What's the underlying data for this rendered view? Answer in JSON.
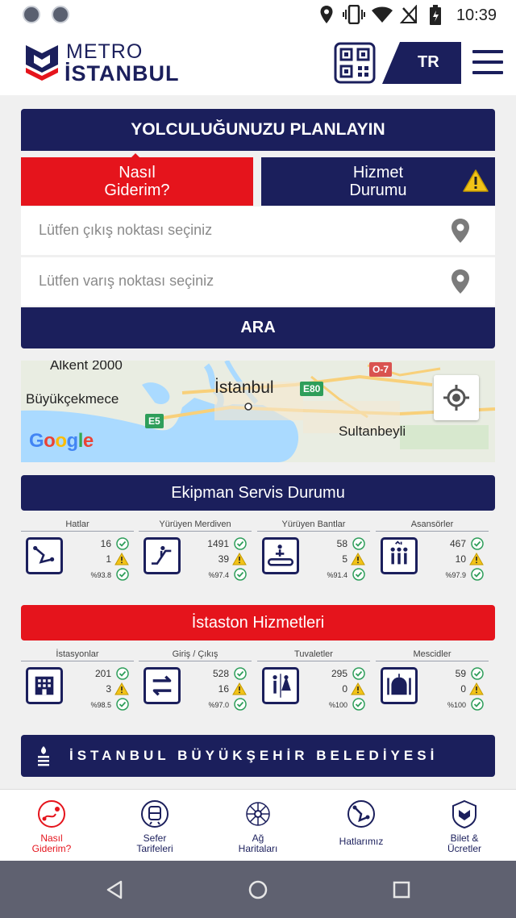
{
  "status_bar": {
    "time": "10:39"
  },
  "header": {
    "logo_line1": "METRO",
    "logo_line2": "İSTANBUL",
    "lang": "TR"
  },
  "planner": {
    "title": "YOLCULUĞUNUZU PLANLAYIN",
    "tab_route_line1": "Nasıl",
    "tab_route_line2": "Giderim?",
    "tab_status_line1": "Hizmet",
    "tab_status_line2": "Durumu",
    "from_placeholder": "Lütfen çıkış noktası seçiniz",
    "to_placeholder": "Lütfen varış noktası seçiniz",
    "search_label": "ARA"
  },
  "map": {
    "labels": [
      "Alkent 2000",
      "Büyükçekmece",
      "İstanbul",
      "Sultanbeyli"
    ],
    "roads": [
      "E5",
      "E80",
      "O-7"
    ],
    "google_letters": [
      "G",
      "o",
      "o",
      "g",
      "l",
      "e"
    ]
  },
  "equipment": {
    "title": "Ekipman Servis Durumu",
    "items": [
      {
        "label": "Hatlar",
        "icon": "metro-line-icon",
        "ok": "16",
        "warn": "1",
        "pct": "%93.8"
      },
      {
        "label": "Yürüyen Merdiven",
        "icon": "escalator-icon",
        "ok": "1491",
        "warn": "39",
        "pct": "%97.4"
      },
      {
        "label": "Yürüyen Bantlar",
        "icon": "moving-walkway-icon",
        "ok": "58",
        "warn": "5",
        "pct": "%91.4"
      },
      {
        "label": "Asansörler",
        "icon": "elevator-icon",
        "ok": "467",
        "warn": "10",
        "pct": "%97.9"
      }
    ]
  },
  "station_services": {
    "title": "İstaston Hizmetleri",
    "items": [
      {
        "label": "İstasyonlar",
        "icon": "station-icon",
        "ok": "201",
        "warn": "3",
        "pct": "%98.5"
      },
      {
        "label": "Giriş / Çıkış",
        "icon": "entrance-exit-icon",
        "ok": "528",
        "warn": "16",
        "pct": "%97.0"
      },
      {
        "label": "Tuvaletler",
        "icon": "toilet-icon",
        "ok": "295",
        "warn": "0",
        "pct": "%100"
      },
      {
        "label": "Mescidler",
        "icon": "mosque-icon",
        "ok": "59",
        "warn": "0",
        "pct": "%100"
      }
    ]
  },
  "ibb_banner": "İSTANBUL BÜYÜKŞEHİR BELEDİYESİ",
  "bottom_nav": [
    {
      "line1": "Nasıl",
      "line2": "Giderim?",
      "icon": "route-icon",
      "active": true
    },
    {
      "line1": "Sefer",
      "line2": "Tarifeleri",
      "icon": "timetable-icon",
      "active": false
    },
    {
      "line1": "Ağ",
      "line2": "Haritaları",
      "icon": "network-map-icon",
      "active": false
    },
    {
      "line1": "Hatlarımız",
      "line2": "",
      "icon": "lines-icon",
      "active": false
    },
    {
      "line1": "Bilet &",
      "line2": "Ücretler",
      "icon": "ticket-icon",
      "active": false
    }
  ],
  "colors": {
    "navy": "#1b1f5c",
    "red": "#e5141c",
    "ok": "#2e9e5a",
    "warn": "#f2c318"
  }
}
